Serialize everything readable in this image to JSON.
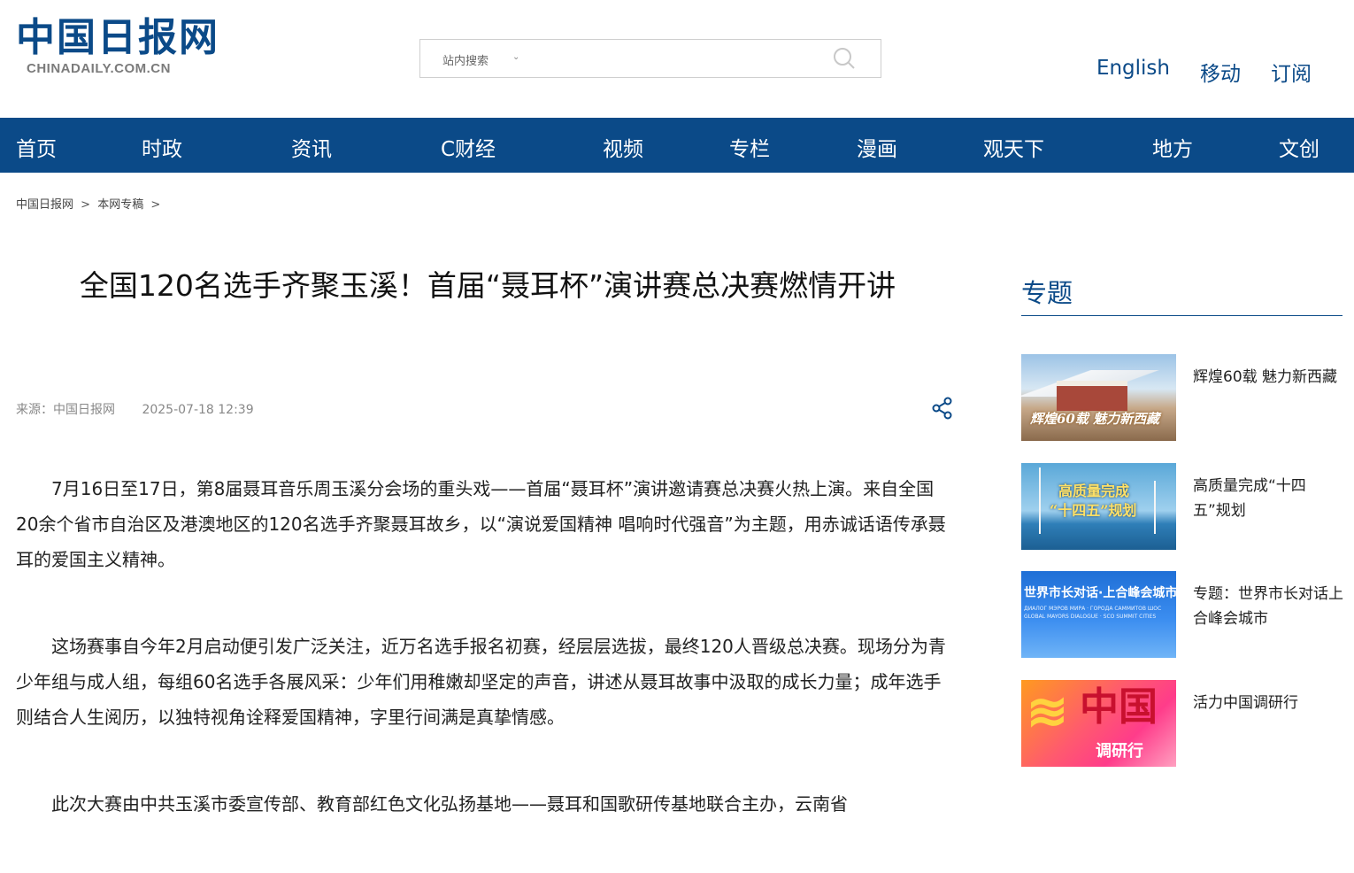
{
  "header": {
    "logo_cn": "中国日报网",
    "logo_en": "CHINADAILY.COM.CN",
    "search": {
      "scope_label": "站内搜索",
      "placeholder": ""
    },
    "links": [
      "English",
      "移动",
      "订阅"
    ]
  },
  "nav": {
    "items": [
      "首页",
      "时政",
      "资讯",
      "C财经",
      "视频",
      "专栏",
      "漫画",
      "观天下",
      "地方",
      "文创"
    ]
  },
  "breadcrumb": {
    "items": [
      "中国日报网",
      "本网专稿"
    ],
    "separator": ">"
  },
  "article": {
    "title": "全国120名选手齐聚玉溪！首届“聂耳杯”演讲赛总决赛燃情开讲",
    "source": "来源：中国日报网",
    "date": "2025-07-18 12:39",
    "paragraphs": [
      "7月16日至17日，第8届聂耳音乐周玉溪分会场的重头戏——首届“聂耳杯”演讲邀请赛总决赛火热上演。来自全国20余个省市自治区及港澳地区的120名选手齐聚聂耳故乡，以“演说爱国精神 唱响时代强音”为主题，用赤诚话语传承聂耳的爱国主义精神。",
      "这场赛事自今年2月启动便引发广泛关注，近万名选手报名初赛，经层层选拔，最终120人晋级总决赛。现场分为青少年组与成人组，每组60名选手各展风采：少年们用稚嫩却坚定的声音，讲述从聂耳故事中汲取的成长力量；成年选手则结合人生阅历，以独特视角诠释爱国精神，字里行间满是真挚情感。",
      "此次大赛由中共玉溪市委宣传部、教育部红色文化弘扬基地——聂耳和国歌研传基地联合主办，云南省"
    ]
  },
  "sidebar": {
    "title": "专题",
    "items": [
      {
        "label": "辉煌60载 魅力新西藏",
        "thumb_caption": "辉煌60载 魅力新西藏"
      },
      {
        "label": "高质量完成“十四五”规划",
        "thumb_caption_1": "高质量完成",
        "thumb_caption_2": "“十四五”规划"
      },
      {
        "label": "专题：世界市长对话上合峰会城市",
        "thumb_caption": "世界市长对话·上合峰会城市",
        "thumb_subcaption": "ДИАЛОГ МЭРОВ МИРА · ГОРОДА САММИТОВ ШОС\nGLOBAL MAYORS DIALOGUE · SCO SUMMIT CITIES"
      },
      {
        "label": "活力中国调研行",
        "thumb_caption_1": "中国",
        "thumb_caption_2": "调研行"
      }
    ]
  },
  "colors": {
    "brand": "#0b4a88",
    "nav_text": "#ffffff"
  }
}
